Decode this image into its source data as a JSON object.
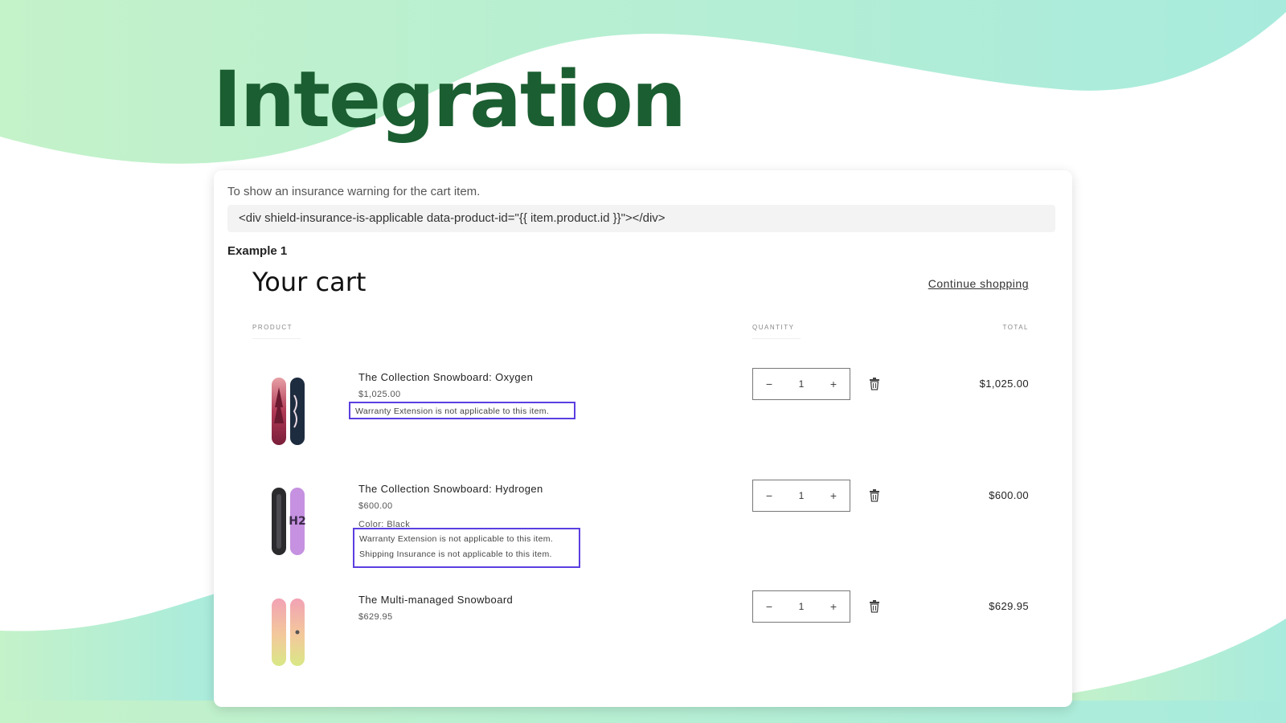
{
  "page": {
    "heading": "Integration",
    "colors": {
      "heading": "#1b5e31",
      "wave_start": "#c4f2c9",
      "wave_end": "#a8ebdd",
      "highlight": "#5b3fe0"
    }
  },
  "card": {
    "intro": "To show an insurance warning for the cart item.",
    "code": "<div shield-insurance-is-applicable data-product-id=\"{{ item.product.id }}\"></div>",
    "example_label": "Example 1"
  },
  "cart": {
    "title": "Your cart",
    "continue_link": "Continue shopping",
    "columns": {
      "product": "PRODUCT",
      "quantity": "QUANTITY",
      "total": "TOTAL"
    },
    "items": [
      {
        "name": "The Collection Snowboard: Oxygen",
        "price": "$1,025.00",
        "quantity": "1",
        "total": "$1,025.00",
        "warnings": [
          "Warranty Extension is not applicable to this item."
        ]
      },
      {
        "name": "The Collection Snowboard: Hydrogen",
        "price": "$600.00",
        "variant": "Color: Black",
        "quantity": "1",
        "total": "$600.00",
        "warnings": [
          "Warranty Extension is not applicable to this item.",
          "Shipping Insurance is not applicable to this item."
        ]
      },
      {
        "name": "The Multi-managed Snowboard",
        "price": "$629.95",
        "quantity": "1",
        "total": "$629.95"
      }
    ],
    "stepper": {
      "minus": "−",
      "plus": "+"
    },
    "icons": {
      "thumbnail": "snowboard-image",
      "remove": "trash-icon"
    }
  }
}
